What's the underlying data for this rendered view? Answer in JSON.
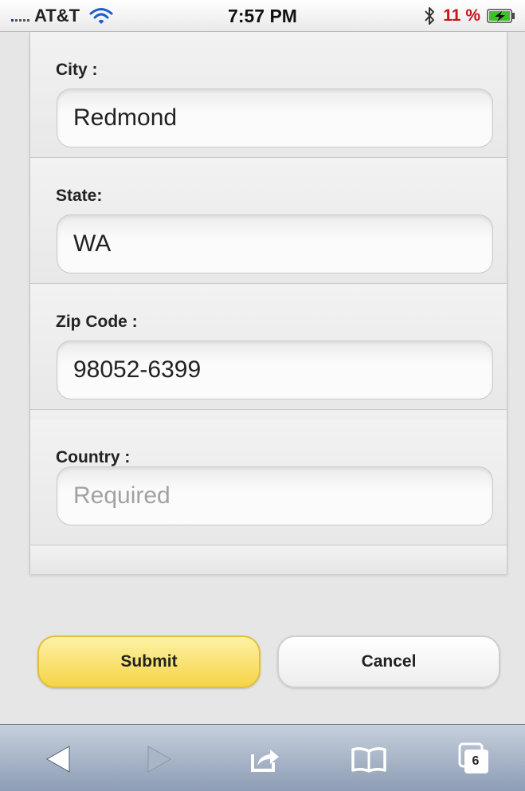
{
  "status_bar": {
    "carrier": "AT&T",
    "time": "7:57 PM",
    "battery_percent": "11 %",
    "colors": {
      "battery_text": "#c8141c",
      "battery_charging": "#3fbf2a"
    }
  },
  "form": {
    "fields": [
      {
        "label": "City :",
        "value": "Redmond",
        "placeholder": ""
      },
      {
        "label": "State:",
        "value": "WA",
        "placeholder": ""
      },
      {
        "label": "Zip Code :",
        "value": "98052-6399",
        "placeholder": ""
      },
      {
        "label": "Country :",
        "value": "",
        "placeholder": "Required"
      }
    ]
  },
  "buttons": {
    "submit_label": "Submit",
    "cancel_label": "Cancel",
    "colors": {
      "submit_bg": "#f6d447",
      "cancel_bg": "#ffffff"
    }
  },
  "toolbar": {
    "icons": [
      "back-arrow-icon",
      "forward-arrow-icon",
      "share-icon",
      "bookmarks-book-icon",
      "tabs-icon"
    ],
    "tab_count": "6"
  }
}
